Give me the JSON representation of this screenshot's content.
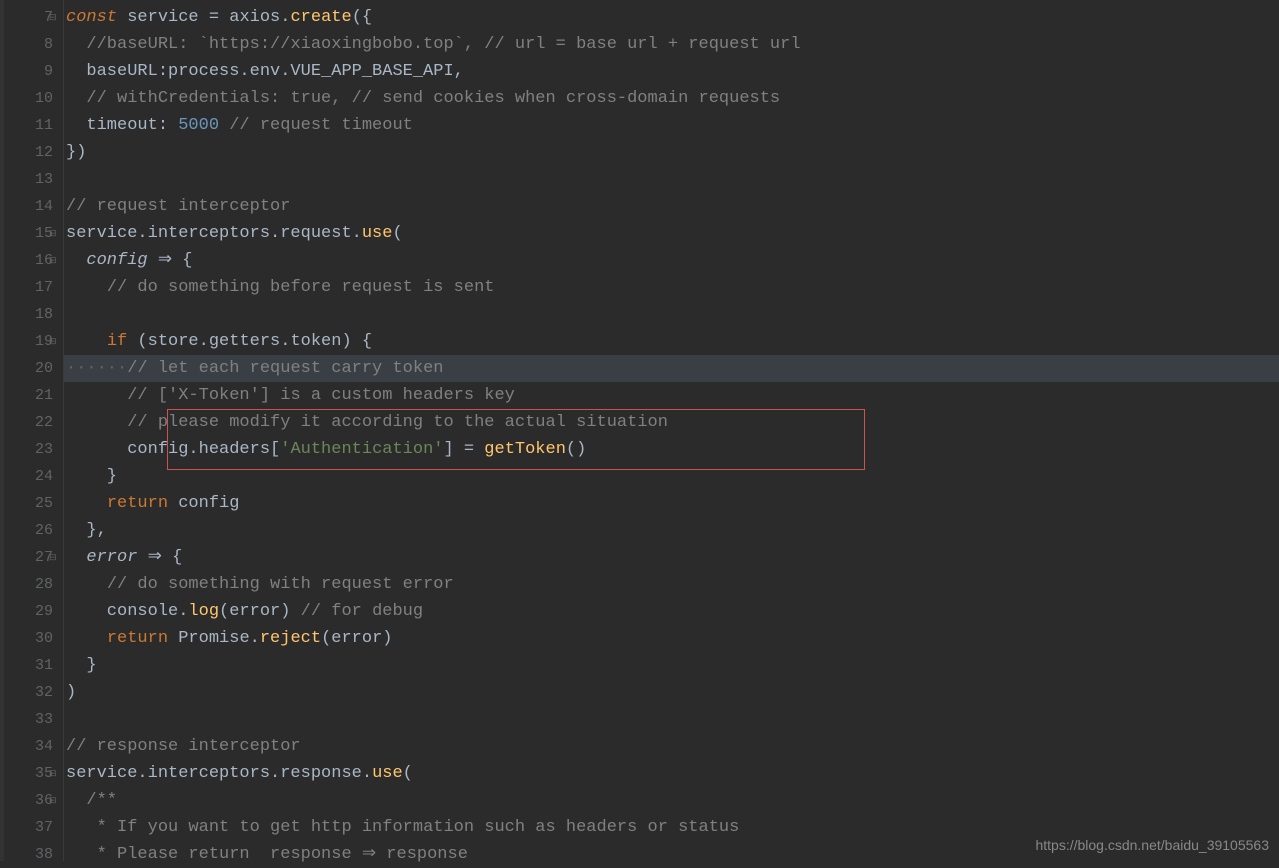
{
  "watermark": "https://blog.csdn.net/baidu_39105563",
  "gutter": {
    "start": 7,
    "end": 38,
    "folds": [
      7,
      15,
      16,
      19,
      27,
      35,
      36
    ]
  },
  "highlight_line_index": 13,
  "redbox": {
    "top_line_index": 15,
    "height_lines": 2
  },
  "code": [
    {
      "segments": [
        {
          "t": "const ",
          "c": "kw-italic"
        },
        {
          "t": "service ",
          "c": "var"
        },
        {
          "t": "= ",
          "c": "var"
        },
        {
          "t": "axios",
          "c": "var"
        },
        {
          "t": ".",
          "c": "var"
        },
        {
          "t": "create",
          "c": "fn"
        },
        {
          "t": "({",
          "c": "var"
        }
      ]
    },
    {
      "segments": [
        {
          "t": "  ",
          "c": "var"
        },
        {
          "t": "//baseURL: `https://xiaoxingbobo.top`, // url = base url + request url",
          "c": "comment"
        }
      ]
    },
    {
      "segments": [
        {
          "t": "  baseURL:process.env.VUE_APP_BASE_API,",
          "c": "var"
        }
      ]
    },
    {
      "segments": [
        {
          "t": "  ",
          "c": "var"
        },
        {
          "t": "// withCredentials: true, // send cookies when cross-domain requests",
          "c": "comment"
        }
      ]
    },
    {
      "segments": [
        {
          "t": "  timeout: ",
          "c": "var"
        },
        {
          "t": "5000 ",
          "c": "num"
        },
        {
          "t": "// request timeout",
          "c": "comment"
        }
      ]
    },
    {
      "segments": [
        {
          "t": "})",
          "c": "var"
        }
      ]
    },
    {
      "segments": [
        {
          "t": "",
          "c": "var"
        }
      ]
    },
    {
      "segments": [
        {
          "t": "// request interceptor",
          "c": "comment"
        }
      ]
    },
    {
      "segments": [
        {
          "t": "service.interceptors.request.",
          "c": "var"
        },
        {
          "t": "use",
          "c": "fn"
        },
        {
          "t": "(",
          "c": "var"
        }
      ]
    },
    {
      "segments": [
        {
          "t": "  ",
          "c": "var"
        },
        {
          "t": "config ",
          "c": "param-italic"
        },
        {
          "t": "⇒ ",
          "c": "var"
        },
        {
          "t": "{",
          "c": "var"
        }
      ]
    },
    {
      "segments": [
        {
          "t": "    ",
          "c": "var"
        },
        {
          "t": "// do something before request is sent",
          "c": "comment"
        }
      ]
    },
    {
      "segments": [
        {
          "t": "",
          "c": "var"
        }
      ]
    },
    {
      "segments": [
        {
          "t": "    ",
          "c": "var"
        },
        {
          "t": "if ",
          "c": "kw"
        },
        {
          "t": "(store.getters.token) {",
          "c": "var"
        }
      ]
    },
    {
      "segments": [
        {
          "t": "······",
          "c": "dots"
        },
        {
          "t": "// let each request carry token",
          "c": "comment"
        }
      ],
      "hl": true
    },
    {
      "segments": [
        {
          "t": "      ",
          "c": "var"
        },
        {
          "t": "// ['X-Token'] is a custom headers key",
          "c": "comment"
        }
      ]
    },
    {
      "segments": [
        {
          "t": "      ",
          "c": "var"
        },
        {
          "t": "// please modify it according to the actual situation",
          "c": "comment"
        }
      ]
    },
    {
      "segments": [
        {
          "t": "      config.headers[",
          "c": "var"
        },
        {
          "t": "'Authentication'",
          "c": "str"
        },
        {
          "t": "] = ",
          "c": "var"
        },
        {
          "t": "getToken",
          "c": "fn"
        },
        {
          "t": "()",
          "c": "var"
        }
      ]
    },
    {
      "segments": [
        {
          "t": "    }",
          "c": "var"
        }
      ]
    },
    {
      "segments": [
        {
          "t": "    ",
          "c": "var"
        },
        {
          "t": "return ",
          "c": "kw"
        },
        {
          "t": "config",
          "c": "var"
        }
      ]
    },
    {
      "segments": [
        {
          "t": "  },",
          "c": "var"
        }
      ]
    },
    {
      "segments": [
        {
          "t": "  ",
          "c": "var"
        },
        {
          "t": "error ",
          "c": "param-italic"
        },
        {
          "t": "⇒ ",
          "c": "var"
        },
        {
          "t": "{",
          "c": "var"
        }
      ]
    },
    {
      "segments": [
        {
          "t": "    ",
          "c": "var"
        },
        {
          "t": "// do something with request error",
          "c": "comment"
        }
      ]
    },
    {
      "segments": [
        {
          "t": "    console",
          "c": "var"
        },
        {
          "t": ".",
          "c": "var"
        },
        {
          "t": "log",
          "c": "fn"
        },
        {
          "t": "(error) ",
          "c": "var"
        },
        {
          "t": "// for debug",
          "c": "comment"
        }
      ]
    },
    {
      "segments": [
        {
          "t": "    ",
          "c": "var"
        },
        {
          "t": "return ",
          "c": "kw"
        },
        {
          "t": "Promise.",
          "c": "var"
        },
        {
          "t": "reject",
          "c": "fn"
        },
        {
          "t": "(error)",
          "c": "var"
        }
      ]
    },
    {
      "segments": [
        {
          "t": "  }",
          "c": "var"
        }
      ]
    },
    {
      "segments": [
        {
          "t": ")",
          "c": "var"
        }
      ]
    },
    {
      "segments": [
        {
          "t": "",
          "c": "var"
        }
      ]
    },
    {
      "segments": [
        {
          "t": "// response interceptor",
          "c": "comment"
        }
      ]
    },
    {
      "segments": [
        {
          "t": "service.interceptors.response.",
          "c": "var"
        },
        {
          "t": "use",
          "c": "fn"
        },
        {
          "t": "(",
          "c": "var"
        }
      ]
    },
    {
      "segments": [
        {
          "t": "  ",
          "c": "var"
        },
        {
          "t": "/**",
          "c": "comment"
        }
      ]
    },
    {
      "segments": [
        {
          "t": "   ",
          "c": "var"
        },
        {
          "t": "* If you want to get http information such as headers or status",
          "c": "comment"
        }
      ]
    },
    {
      "segments": [
        {
          "t": "   ",
          "c": "var"
        },
        {
          "t": "* Please return  response ⇒ response",
          "c": "comment"
        }
      ]
    }
  ]
}
